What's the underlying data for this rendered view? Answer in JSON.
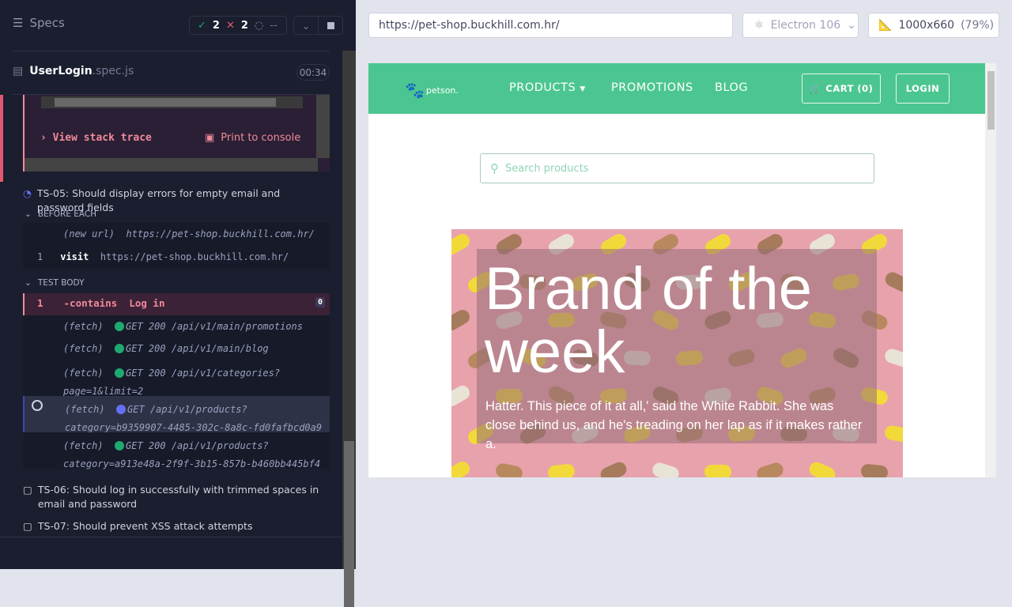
{
  "reporter": {
    "title": "Specs",
    "passed": "2",
    "failed": "2",
    "pending": "--",
    "spec_name": "UserLogin",
    "spec_ext": ".spec.js",
    "duration": "00:34",
    "error": {
      "view_stack": "View stack trace",
      "print_console": "Print to console"
    },
    "tests": [
      {
        "title": "TS-05: Should display errors for empty email and password fields",
        "state": "running"
      },
      {
        "title": "TS-06: Should log in successfully with trimmed spaces in email and password",
        "state": "pending"
      },
      {
        "title": "TS-07: Should prevent XSS attack attempts",
        "state": "pending"
      }
    ],
    "before_each": {
      "label": "BEFORE EACH",
      "new_url": "(new url)",
      "new_url_value": "https://pet-shop.buckhill.com.hr/",
      "visit_num": "1",
      "visit": "visit",
      "visit_value": "https://pet-shop.buckhill.com.hr/"
    },
    "test_body": {
      "label": "TEST BODY",
      "num": "1",
      "cmd": "-contains",
      "arg": "Log in",
      "badge": "0",
      "fetches": [
        {
          "label": "(fetch)",
          "text": "GET 200 /api/v1/main/promotions",
          "status": "#1fa971"
        },
        {
          "label": "(fetch)",
          "text": "GET 200 /api/v1/main/blog",
          "status": "#1fa971"
        },
        {
          "label": "(fetch)",
          "text": "GET 200 /api/v1/categories?",
          "text2": "page=1&limit=2",
          "status": "#1fa971"
        },
        {
          "label": "(fetch)",
          "text": "GET /api/v1/products?",
          "text2": "category=b9359907-4485-302c-8a8c-fd0fafbcd0a9",
          "status": "#6470f3"
        },
        {
          "label": "(fetch)",
          "text": "GET 200 /api/v1/products?",
          "text2": "category=a913e48a-2f9f-3b15-857b-b460bb445bf4",
          "status": "#1fa971"
        }
      ]
    }
  },
  "toolbar": {
    "url": "https://pet-shop.buckhill.com.hr/",
    "browser": "Electron 106",
    "viewport": "1000x660",
    "scale": "(79%)"
  },
  "app": {
    "logo": "petson.",
    "nav": [
      "PRODUCTS",
      "PROMOTIONS",
      "BLOG"
    ],
    "cart": "CART (0)",
    "login": "LOGIN",
    "search_placeholder": "Search products",
    "hero_title": "Brand of the week",
    "hero_text": "Hatter. This piece of it at all,' said the White Rabbit. She was close behind us, and he's treading on her lap as if it makes rather a.",
    "brand_color": "#4cc690"
  }
}
